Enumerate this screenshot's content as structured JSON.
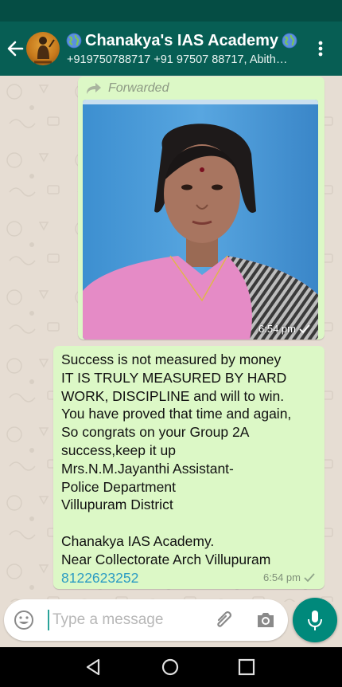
{
  "header": {
    "title": "Chanakya's IAS Academy",
    "subtitle": "+919750788717 +91 97507 88717, Abith…",
    "globe_icon": "globe-emoji",
    "avatar_icon": "group-avatar"
  },
  "messages": [
    {
      "type": "image",
      "forwarded_label": "Forwarded",
      "time": "6:54 pm",
      "status": "sent"
    },
    {
      "type": "text",
      "lines": [
        "Success is not measured by money",
        "IT IS TRULY MEASURED BY HARD",
        "WORK, DISCIPLINE and will to win.",
        "You have proved that time and again,",
        "So congrats on your Group 2A",
        "success,keep it up",
        "Mrs.N.M.Jayanthi Assistant-",
        "Police Department",
        "Villupuram District",
        "",
        "Chanakya IAS Academy.",
        "Near Collectorate Arch Villupuram"
      ],
      "phone_link": "8122623252",
      "time": "6:54 pm",
      "status": "sent"
    }
  ],
  "composer": {
    "placeholder": "Type a message"
  },
  "colors": {
    "app_bar": "#075e54",
    "bubble": "#dcf8c6",
    "chat_background": "#e6ddd3",
    "fab": "#00897b",
    "link": "#2a9bc3"
  }
}
